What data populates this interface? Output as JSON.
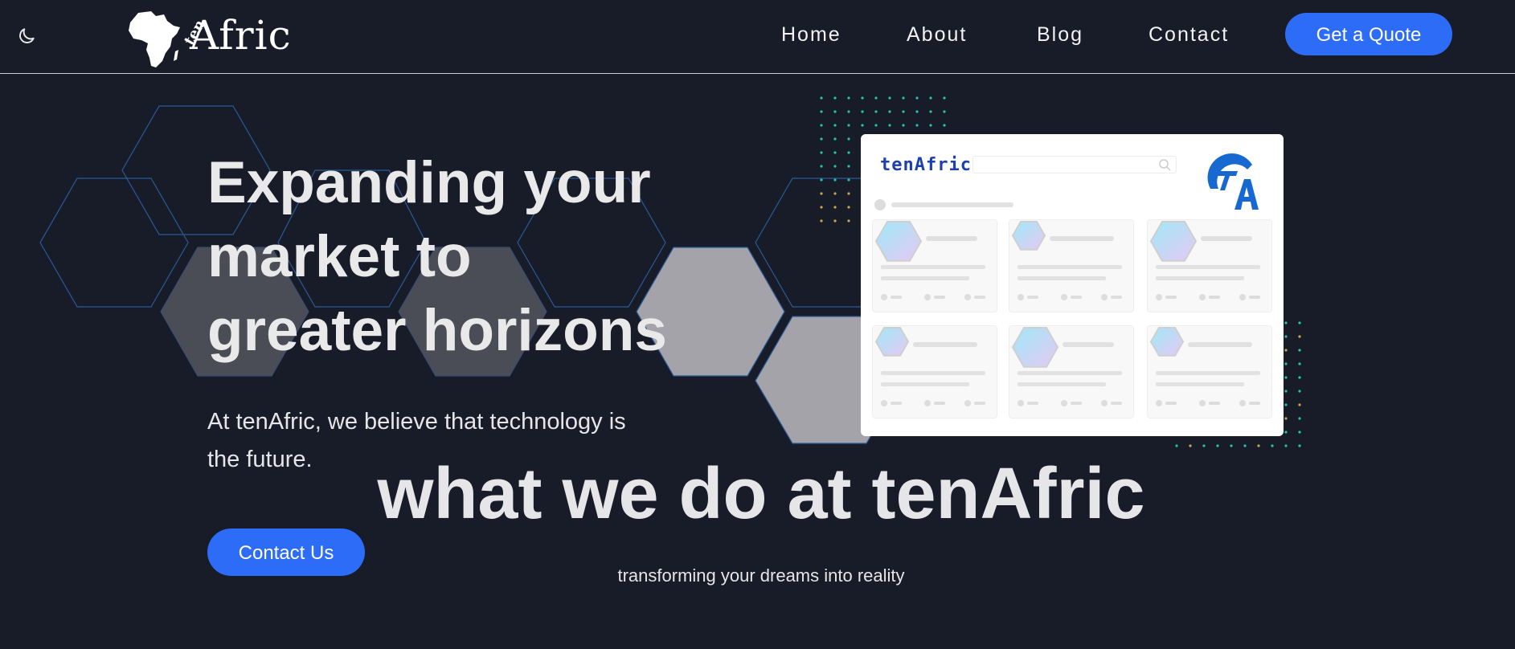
{
  "header": {
    "theme_toggle_icon": "moon-icon",
    "logo": {
      "text": "Afric",
      "prefix": "ten",
      "icon": "africa-map-icon"
    },
    "nav": [
      {
        "label": "Home"
      },
      {
        "label": "About"
      },
      {
        "label": "Blog"
      },
      {
        "label": "Contact"
      }
    ],
    "cta_label": "Get a Quote"
  },
  "hero": {
    "title_lines": [
      "Expanding your",
      "market to",
      "greater horizons"
    ],
    "subtitle_lines": [
      "At tenAfric, we believe that technology is",
      "the future."
    ],
    "cta_label": "Contact Us"
  },
  "mockup": {
    "brand": "tenAfric",
    "logo_mark": "TA",
    "search_icon": "search-icon",
    "card_count_label": "6"
  },
  "section": {
    "title": "what we do at tenAfric",
    "subtitle": "transforming your dreams into reality"
  },
  "colors": {
    "background": "#181c29",
    "accent": "#2d6cf6",
    "hex_outline": "#2a5a98",
    "hex_fill": "#a3a3a9",
    "dots_teal": "#27c3a8",
    "dots_gold": "#c9a64a"
  }
}
